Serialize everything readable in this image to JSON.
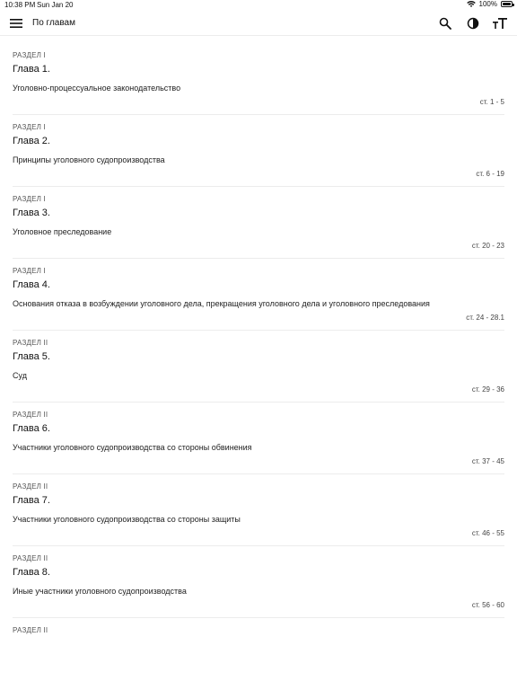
{
  "status": {
    "time": "10:38 PM",
    "date": "Sun Jan 20",
    "battery": "100%"
  },
  "header": {
    "title": "По главам"
  },
  "chapters": [
    {
      "section": "РАЗДЕЛ I",
      "chapter": "Глава 1.",
      "name": "Уголовно-процессуальное законодательство",
      "range": "ст. 1 - 5"
    },
    {
      "section": "РАЗДЕЛ I",
      "chapter": "Глава 2.",
      "name": "Принципы уголовного судопроизводства",
      "range": "ст. 6 - 19"
    },
    {
      "section": "РАЗДЕЛ I",
      "chapter": "Глава 3.",
      "name": "Уголовное преследование",
      "range": "ст. 20 - 23"
    },
    {
      "section": "РАЗДЕЛ I",
      "chapter": "Глава 4.",
      "name": "Основания отказа в возбуждении уголовного дела, прекращения уголовного дела и уголовного преследования",
      "range": "ст. 24 - 28.1"
    },
    {
      "section": "РАЗДЕЛ II",
      "chapter": "Глава 5.",
      "name": "Суд",
      "range": "ст. 29 - 36"
    },
    {
      "section": "РАЗДЕЛ II",
      "chapter": "Глава 6.",
      "name": "Участники уголовного судопроизводства со стороны обвинения",
      "range": "ст. 37 - 45"
    },
    {
      "section": "РАЗДЕЛ II",
      "chapter": "Глава 7.",
      "name": "Участники уголовного судопроизводства со стороны защиты",
      "range": "ст. 46 - 55"
    },
    {
      "section": "РАЗДЕЛ II",
      "chapter": "Глава 8.",
      "name": "Иные участники уголовного судопроизводства",
      "range": "ст. 56 - 60"
    },
    {
      "section": "РАЗДЕЛ II",
      "chapter": "",
      "name": "",
      "range": ""
    }
  ]
}
